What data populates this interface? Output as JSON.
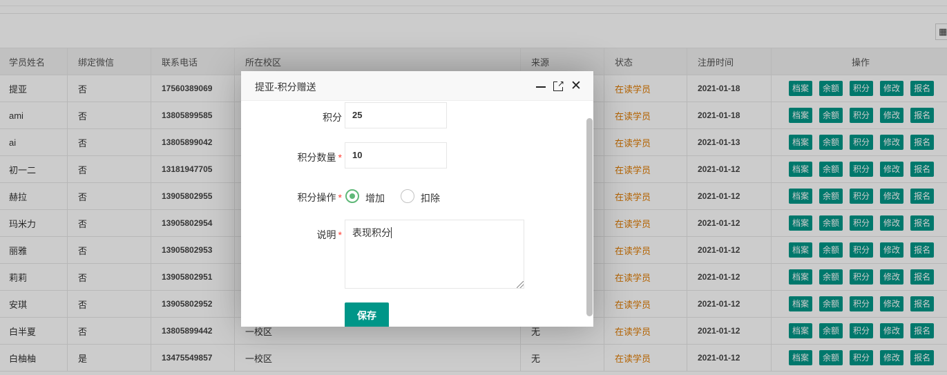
{
  "toolbar": {
    "columns_icon": "columns-grid-icon"
  },
  "table": {
    "headers": [
      "学员姓名",
      "绑定微信",
      "联系电话",
      "所在校区",
      "来源",
      "状态",
      "注册时间",
      "操作"
    ],
    "rows": [
      {
        "name": "提亚",
        "wechat": "否",
        "phone": "17560389069",
        "campus": "",
        "source": "",
        "status": "在读学员",
        "date": "2021-01-18"
      },
      {
        "name": "ami",
        "wechat": "否",
        "phone": "13805899585",
        "campus": "",
        "source": "",
        "status": "在读学员",
        "date": "2021-01-18"
      },
      {
        "name": "ai",
        "wechat": "否",
        "phone": "13805899042",
        "campus": "",
        "source": "",
        "status": "在读学员",
        "date": "2021-01-13"
      },
      {
        "name": "初一二",
        "wechat": "否",
        "phone": "13181947705",
        "campus": "",
        "source": "",
        "status": "在读学员",
        "date": "2021-01-12"
      },
      {
        "name": "赫拉",
        "wechat": "否",
        "phone": "13905802955",
        "campus": "",
        "source": "",
        "status": "在读学员",
        "date": "2021-01-12"
      },
      {
        "name": "玛米力",
        "wechat": "否",
        "phone": "13905802954",
        "campus": "",
        "source": "",
        "status": "在读学员",
        "date": "2021-01-12"
      },
      {
        "name": "丽雅",
        "wechat": "否",
        "phone": "13905802953",
        "campus": "",
        "source": "",
        "status": "在读学员",
        "date": "2021-01-12"
      },
      {
        "name": "莉莉",
        "wechat": "否",
        "phone": "13905802951",
        "campus": "",
        "source": "",
        "status": "在读学员",
        "date": "2021-01-12"
      },
      {
        "name": "安琪",
        "wechat": "否",
        "phone": "13905802952",
        "campus": "",
        "source": "",
        "status": "在读学员",
        "date": "2021-01-12"
      },
      {
        "name": "白半夏",
        "wechat": "否",
        "phone": "13805899442",
        "campus": "一校区",
        "source": "无",
        "status": "在读学员",
        "date": "2021-01-12"
      },
      {
        "name": "白柚柚",
        "wechat": "是",
        "phone": "13475549857",
        "campus": "一校区",
        "source": "无",
        "status": "在读学员",
        "date": "2021-01-12"
      }
    ],
    "actions": [
      "档案",
      "余额",
      "积分",
      "修改",
      "报名"
    ]
  },
  "modal": {
    "title": "提亚-积分赠送",
    "points_label": "积分",
    "points_value": "25",
    "amount_label": "积分数量",
    "amount_value": "10",
    "operation_label": "积分操作",
    "op_add": "增加",
    "op_deduct": "扣除",
    "note_label": "说明",
    "note_value": "表现积分",
    "required_mark": "*",
    "save_label": "保存",
    "close_glyph": "✕",
    "max_glyph": "↗"
  },
  "colors": {
    "accent": "#009688",
    "status": "#e07b00",
    "radio_on": "#5fb878",
    "required": "#ff3b30"
  }
}
